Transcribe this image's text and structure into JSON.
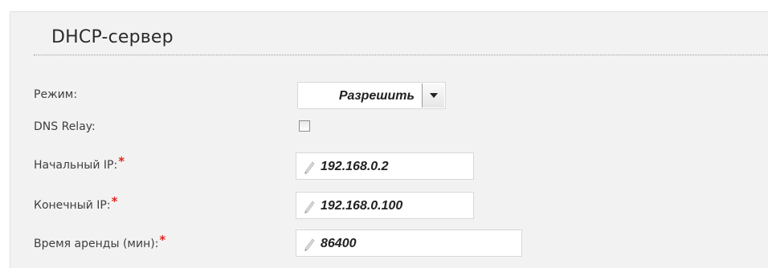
{
  "section": {
    "title": "DHCP-сервер"
  },
  "mode": {
    "label": "Режим:",
    "value": "Разрешить"
  },
  "dns_relay": {
    "label": "DNS Relay:",
    "checked": false
  },
  "start_ip": {
    "label": "Начальный IP:",
    "required_mark": "*",
    "value": "192.168.0.2",
    "icon": "pencil-icon"
  },
  "end_ip": {
    "label": "Конечный IP:",
    "required_mark": "*",
    "value": "192.168.0.100",
    "icon": "pencil-icon"
  },
  "lease_time": {
    "label": "Время аренды (мин):",
    "required_mark": "*",
    "value": "86400",
    "icon": "pencil-icon"
  },
  "colors": {
    "required": "#e0281e",
    "panel": "#f2f2f2"
  }
}
